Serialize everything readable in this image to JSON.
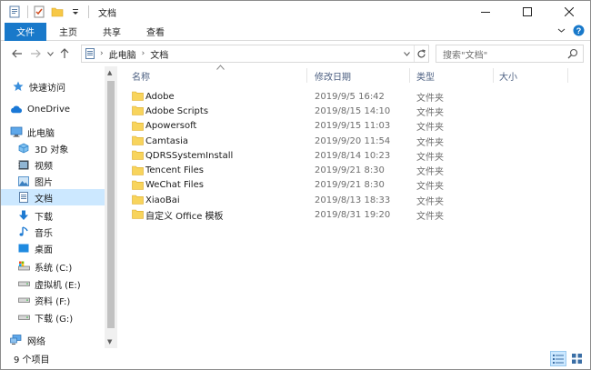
{
  "window": {
    "title": "文档",
    "accent": "#1979ca"
  },
  "ribbon": {
    "tabs": [
      {
        "label": "文件"
      },
      {
        "label": "主页"
      },
      {
        "label": "共享"
      },
      {
        "label": "查看"
      }
    ]
  },
  "address": {
    "crumbs": [
      "此电脑",
      "文档"
    ],
    "search_placeholder": "搜索\"文档\""
  },
  "sidebar": {
    "items": [
      {
        "label": "快速访问",
        "icon": "star-icon"
      },
      {
        "label": "OneDrive",
        "icon": "cloud-icon"
      },
      {
        "label": "此电脑",
        "icon": "pc-icon"
      },
      {
        "label": "3D 对象",
        "icon": "cube-icon"
      },
      {
        "label": "视频",
        "icon": "video-icon"
      },
      {
        "label": "图片",
        "icon": "picture-icon"
      },
      {
        "label": "文档",
        "icon": "document-icon",
        "selected": true
      },
      {
        "label": "下载",
        "icon": "download-arrow-icon"
      },
      {
        "label": "音乐",
        "icon": "music-note-icon"
      },
      {
        "label": "桌面",
        "icon": "desktop-icon"
      },
      {
        "label": "系统 (C:)",
        "icon": "system-drive-icon"
      },
      {
        "label": "虚拟机 (E:)",
        "icon": "drive-icon"
      },
      {
        "label": "资料 (F:)",
        "icon": "drive-icon"
      },
      {
        "label": "下载 (G:)",
        "icon": "drive-icon"
      },
      {
        "label": "网络",
        "icon": "network-icon"
      }
    ]
  },
  "columns": {
    "name": "名称",
    "date": "修改日期",
    "type": "类型",
    "size": "大小"
  },
  "files": [
    {
      "name": "Adobe",
      "date": "2019/9/5 16:42",
      "type": "文件夹"
    },
    {
      "name": "Adobe Scripts",
      "date": "2019/8/15 14:10",
      "type": "文件夹"
    },
    {
      "name": "Apowersoft",
      "date": "2019/9/15 11:03",
      "type": "文件夹"
    },
    {
      "name": "Camtasia",
      "date": "2019/9/20 11:54",
      "type": "文件夹"
    },
    {
      "name": "QDRSSystemInstall",
      "date": "2019/8/14 10:23",
      "type": "文件夹"
    },
    {
      "name": "Tencent Files",
      "date": "2019/9/21 8:30",
      "type": "文件夹"
    },
    {
      "name": "WeChat Files",
      "date": "2019/9/21 8:30",
      "type": "文件夹"
    },
    {
      "name": "XiaoBai",
      "date": "2019/8/13 18:33",
      "type": "文件夹"
    },
    {
      "name": "自定义 Office 模板",
      "date": "2019/8/31 19:20",
      "type": "文件夹"
    }
  ],
  "status": {
    "count_text": "9 个项目"
  }
}
